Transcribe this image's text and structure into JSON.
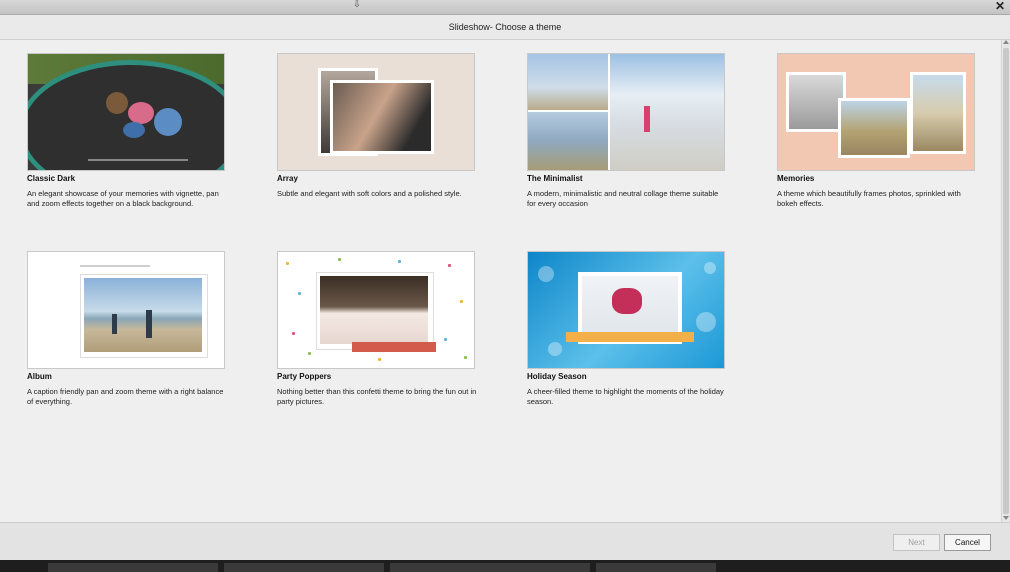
{
  "window": {
    "title": "Slideshow- Choose a theme"
  },
  "themes": [
    {
      "title": "Classic Dark",
      "desc": "An elegant showcase of your memories with vignette, pan and zoom effects together on a black background."
    },
    {
      "title": "Array",
      "desc": "Subtle and elegant with soft colors and a polished style."
    },
    {
      "title": "The Minimalist",
      "desc": "A modern, minimalistic and neutral collage theme suitable for every occasion"
    },
    {
      "title": "Memories",
      "desc": "A theme which beautifully frames photos, sprinkled with bokeh effects."
    },
    {
      "title": "Album",
      "desc": "A caption friendly pan and zoom theme with a right balance of everything."
    },
    {
      "title": "Party Poppers",
      "desc": "Nothing better than this confetti theme to bring the fun out in party pictures."
    },
    {
      "title": "Holiday Season",
      "desc": "A cheer-filled theme to highlight the moments of the holiday season."
    }
  ],
  "footer": {
    "next_label": "Next",
    "cancel_label": "Cancel"
  },
  "icons": {
    "close": "close-icon",
    "drag": "drag-handle-icon"
  }
}
